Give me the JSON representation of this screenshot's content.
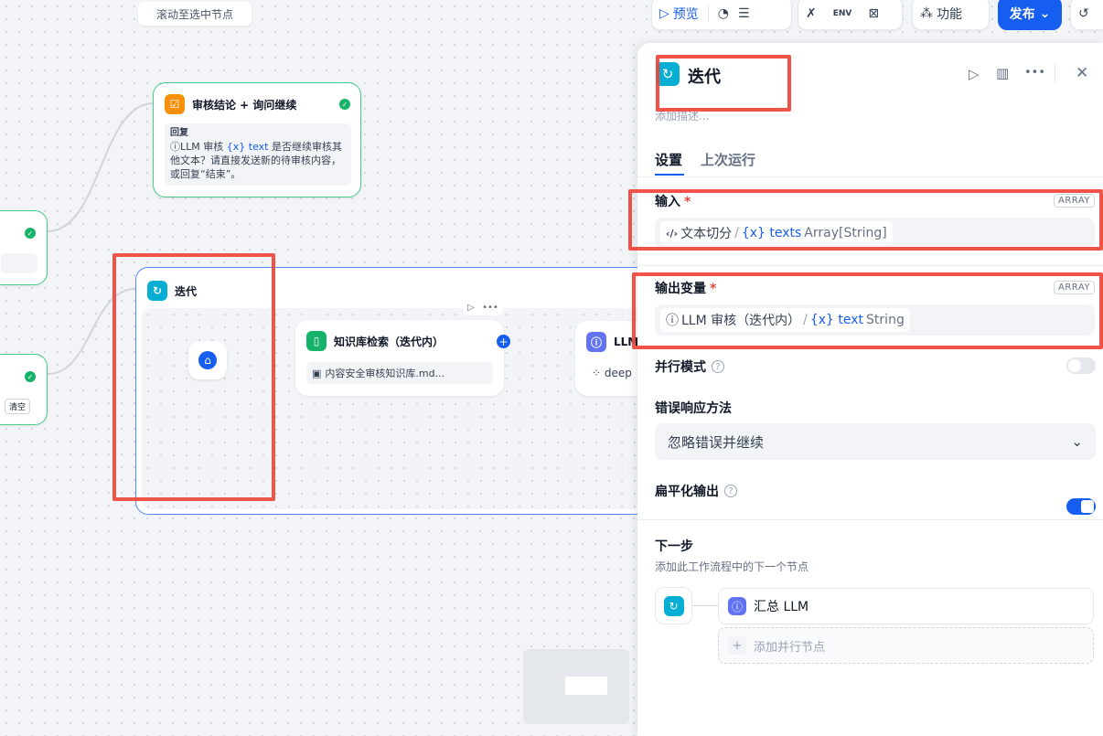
{
  "canvas": {
    "scroll_chip": "滚动至选中节点",
    "review_node": {
      "title": "审核结论 + 询问继续",
      "reply_label": "回复",
      "llm_ref": "LLM 审核",
      "var_ref": "{x} text",
      "body": "是否继续审核其他文本？请直接发送新的待审核内容，或回复“结束”。"
    },
    "clear_chip": "清空",
    "iteration_node": {
      "title": "迭代"
    },
    "kb_node": {
      "title": "知识库检索（迭代内）",
      "file": "内容安全审核知识库.md..."
    },
    "llm_node": {
      "title_partial": "LLM",
      "model_partial": "deep"
    }
  },
  "toolbar": {
    "preview": "预览",
    "env": "ENV",
    "features": "功能",
    "publish": "发布"
  },
  "panel": {
    "title": "迭代",
    "desc_placeholder": "添加描述...",
    "tabs": [
      "设置",
      "上次运行"
    ],
    "input": {
      "label": "输入",
      "type_badge": "ARRAY",
      "source_node": "文本切分",
      "separator": "/",
      "var_name": "{x} texts",
      "var_type": "Array[String]"
    },
    "output": {
      "label": "输出变量",
      "type_badge": "ARRAY",
      "source_node": "LLM 审核（迭代内）",
      "separator": "/",
      "var_name": "{x} text",
      "var_type": "String"
    },
    "parallel_mode": {
      "label": "并行模式",
      "enabled": false
    },
    "error_handling": {
      "label": "错误响应方法",
      "value": "忽略错误并继续"
    },
    "flatten_output": {
      "label": "扁平化输出",
      "enabled": true
    },
    "next_step": {
      "title": "下一步",
      "desc": "添加此工作流程中的下一个节点",
      "next_node": "汇总 LLM",
      "add_parallel": "添加并行节点"
    }
  },
  "colors": {
    "accent": "#155eef",
    "highlight": "#f04438",
    "iteration_icon": "#06aed4"
  }
}
